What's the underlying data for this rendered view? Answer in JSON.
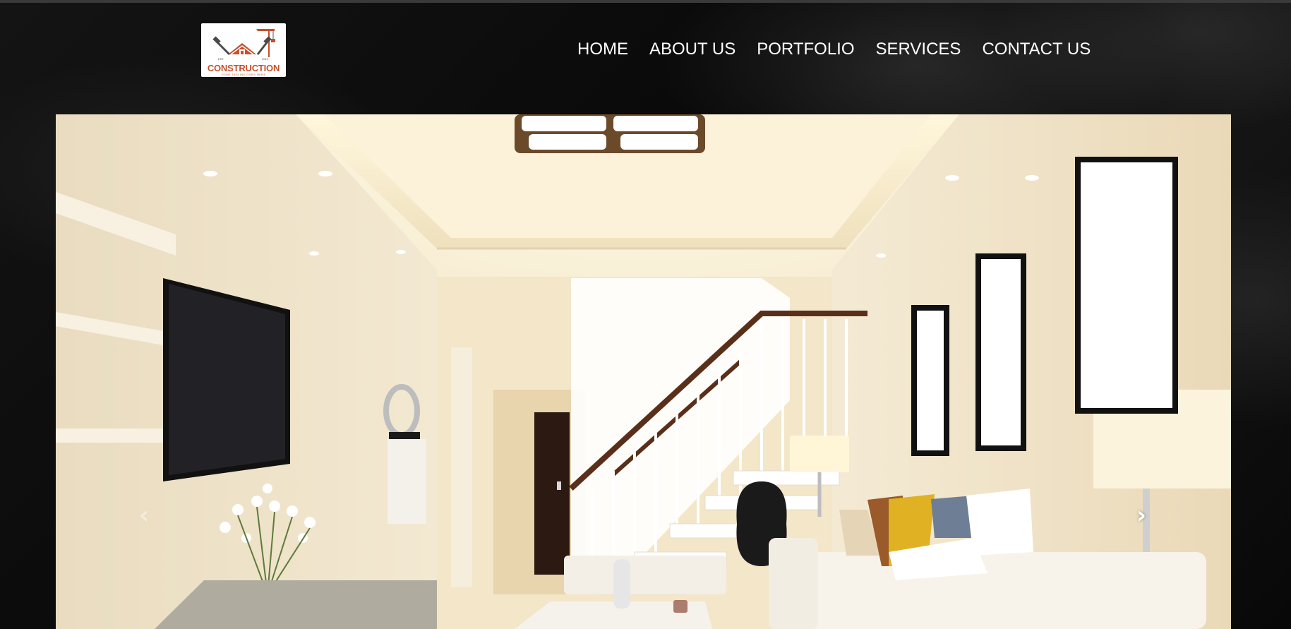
{
  "header": {
    "logo": {
      "name": "CONSTRUCTION",
      "tagline": "YOUR TAGLINE GOES HERE",
      "est_left": "EST.",
      "est_right": "2019",
      "brand_color": "#c7502b"
    },
    "nav": [
      {
        "label": "HOME"
      },
      {
        "label": "ABOUT US"
      },
      {
        "label": "PORTFOLIO"
      },
      {
        "label": "SERVICES"
      },
      {
        "label": "CONTACT US"
      }
    ],
    "nav_text_color": "#ffffff"
  },
  "hero": {
    "prev_icon": "chevron-left-icon",
    "next_icon": "chevron-right-icon",
    "prev_glyph": "‹",
    "next_glyph": "›",
    "scene": "living-room-interior-image"
  },
  "colors": {
    "page_background": "#0b0b0b",
    "hero_wall": "#efe2c6"
  }
}
